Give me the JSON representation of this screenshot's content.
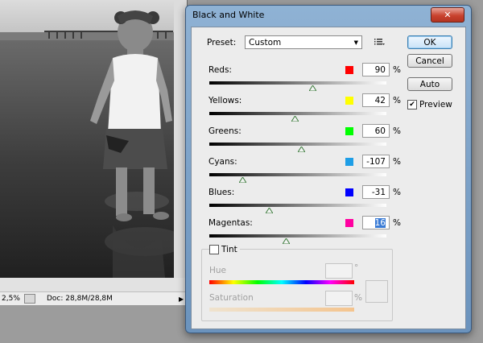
{
  "status": {
    "zoom": "2,5%",
    "doc_info": "Doc: 28,8M/28,8M",
    "arrow": "▶"
  },
  "dialog": {
    "title": "Black and White",
    "close_glyph": "✕",
    "preset_label": "Preset:",
    "preset_value": "Custom",
    "preset_menu_icon": "menu-list-icon",
    "buttons": {
      "ok": "OK",
      "cancel": "Cancel",
      "auto": "Auto"
    },
    "preview_label": "Preview",
    "preview_checked": true,
    "percent_sign": "%",
    "sliders": [
      {
        "label": "Reds:",
        "value": "90",
        "color": "#ff0000"
      },
      {
        "label": "Yellows:",
        "value": "42",
        "color": "#ffff00"
      },
      {
        "label": "Greens:",
        "value": "60",
        "color": "#00ff00"
      },
      {
        "label": "Cyans:",
        "value": "-107",
        "color": "#1e9ee6"
      },
      {
        "label": "Blues:",
        "value": "-31",
        "color": "#0000ff"
      },
      {
        "label": "Magentas:",
        "value": "16",
        "color": "#ff00a0"
      }
    ],
    "tint": {
      "label": "Tint",
      "checked": false,
      "hue_label": "Hue",
      "hue_unit": "°",
      "saturation_label": "Saturation",
      "saturation_unit": "%"
    }
  }
}
